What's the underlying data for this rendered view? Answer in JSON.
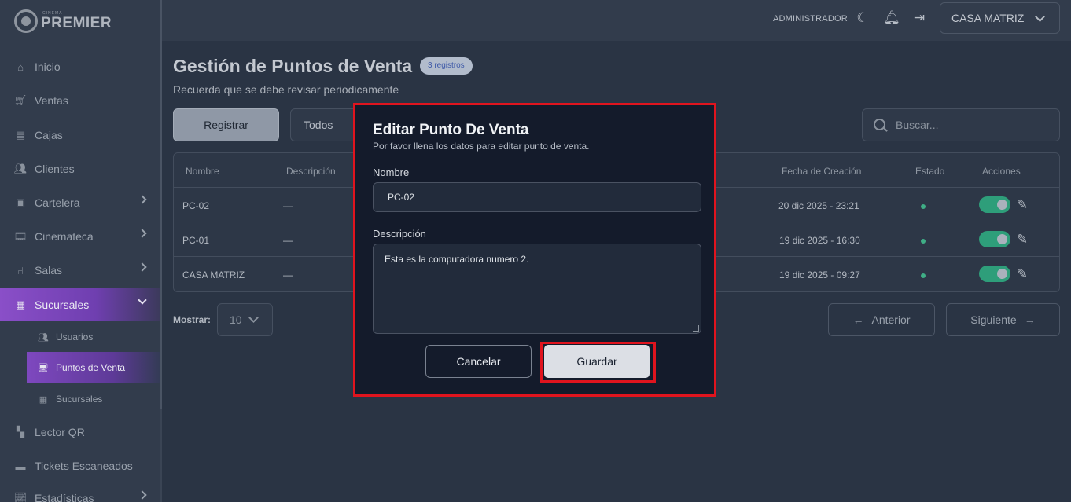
{
  "brand": {
    "small": "CINEMA",
    "name": "PREMIER"
  },
  "sidebar": {
    "items": [
      {
        "label": "Inicio",
        "icon": "home-icon"
      },
      {
        "label": "Ventas",
        "icon": "cart-icon"
      },
      {
        "label": "Cajas",
        "icon": "register-icon"
      },
      {
        "label": "Clientes",
        "icon": "users-icon"
      },
      {
        "label": "Cartelera",
        "icon": "ticket-icon"
      },
      {
        "label": "Cinemateca",
        "icon": "film-icon"
      },
      {
        "label": "Salas",
        "icon": "seat-icon"
      },
      {
        "label": "Sucursales",
        "icon": "store-icon"
      },
      {
        "label": "Lector QR",
        "icon": "qr-icon"
      },
      {
        "label": "Tickets Escaneados",
        "icon": "scanned-icon"
      },
      {
        "label": "Estadísticas",
        "icon": "chart-icon"
      }
    ],
    "sub_items": [
      {
        "label": "Usuarios",
        "icon": "users-icon"
      },
      {
        "label": "Puntos de Venta",
        "icon": "pos-icon"
      },
      {
        "label": "Sucursales",
        "icon": "store-icon"
      }
    ]
  },
  "topbar": {
    "user_role": "ADMINISTRADOR",
    "branch": "CASA MATRIZ"
  },
  "page": {
    "title": "Gestión de Puntos de Venta",
    "badge": "3 registros",
    "subtitle": "Recuerda que se debe revisar periodicamente",
    "register_label": "Registrar",
    "filter_value": "Todos",
    "search_placeholder": "Buscar..."
  },
  "table": {
    "headers": [
      "Nombre",
      "Descripción",
      "Fecha de Creación",
      "Estado",
      "Acciones"
    ],
    "rows": [
      {
        "nombre": "PC-02",
        "descripcion": "—",
        "fecha": "20 dic 2025 - 23:21"
      },
      {
        "nombre": "PC-01",
        "descripcion": "—",
        "fecha": "19 dic 2025 - 16:30"
      },
      {
        "nombre": "CASA MATRIZ",
        "descripcion": "—",
        "fecha": "19 dic 2025 - 09:27"
      }
    ]
  },
  "pagination": {
    "show_label": "Mostrar:",
    "page_size": "10",
    "prev_label": "Anterior",
    "next_label": "Siguiente"
  },
  "modal": {
    "title": "Editar Punto De Venta",
    "subtitle": "Por favor llena los datos para editar punto de venta.",
    "name_label": "Nombre",
    "name_value": "PC-02",
    "desc_label": "Descripción",
    "desc_value": "Esta es la computadora numero 2.",
    "cancel_label": "Cancelar",
    "save_label": "Guardar"
  },
  "colors": {
    "accent_purple": "#7e48bf",
    "status_green": "#2e9e7a",
    "highlight_red": "#e0141e"
  }
}
